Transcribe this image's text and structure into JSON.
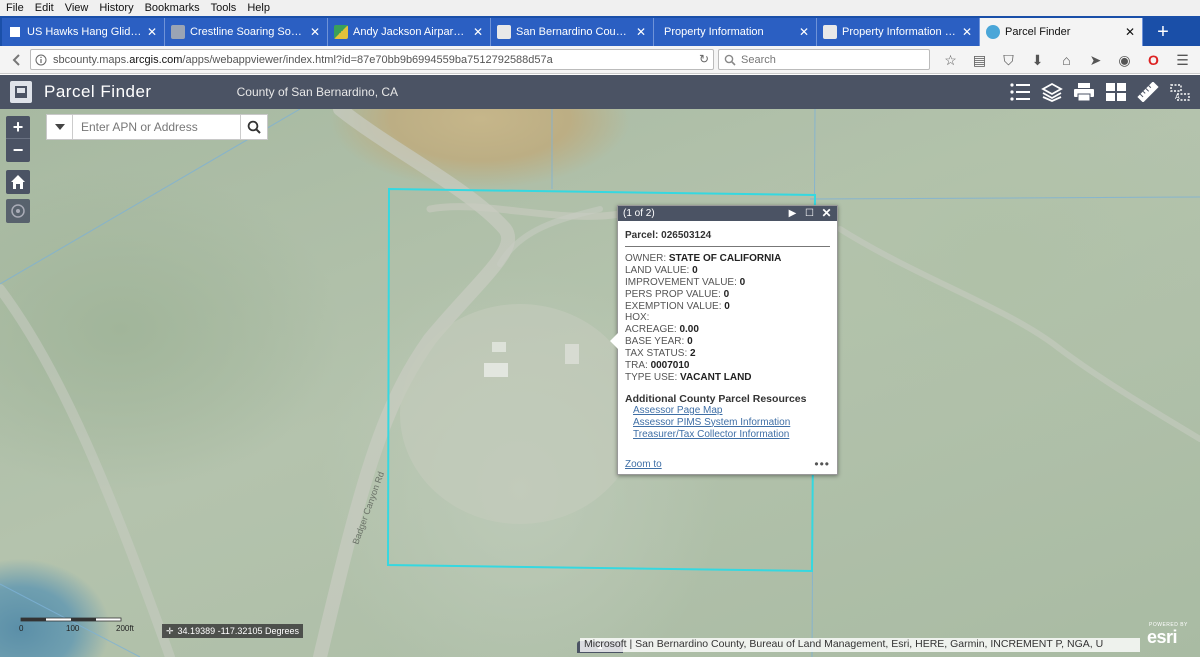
{
  "menu": [
    "File",
    "Edit",
    "View",
    "History",
    "Bookmarks",
    "Tools",
    "Help"
  ],
  "tabs": [
    {
      "label": "US Hawks Hang Gliding Assoc...",
      "fav_color": "#2b5fc2"
    },
    {
      "label": "Crestline Soaring Society |...",
      "fav_color": "#9aa4b4"
    },
    {
      "label": "Andy Jackson Airpark - Go...",
      "fav_color": "#3aa05a"
    },
    {
      "label": "San Bernardino County - C...",
      "fav_color": "#e8e8e8"
    },
    {
      "label": "Property Information",
      "fav_color": "#2b5fc2"
    },
    {
      "label": "Property Information Mana...",
      "fav_color": "#e8e8e8"
    },
    {
      "label": "Parcel Finder",
      "fav_color": "#4aa6d8"
    }
  ],
  "newtab": "+",
  "url": {
    "prefix": "sbcounty.maps.",
    "domain": "arcgis.com",
    "path": "/apps/webappviewer/index.html?id=87e70bb9b6994559ba7512792588d57a"
  },
  "browser_search": {
    "placeholder": "Search"
  },
  "app": {
    "title": "Parcel Finder",
    "subtitle": "County of San Bernardino, CA"
  },
  "search_widget": {
    "placeholder": "Enter APN or Address"
  },
  "map": {
    "road_label": "Badger Canyon Rd",
    "parcel_outline_color": "#35d8e0"
  },
  "zoom": {
    "in": "+",
    "out": "−"
  },
  "popup": {
    "page": "(1 of 2)",
    "title": "Parcel: 026503124",
    "fields": [
      {
        "label": "OWNER:",
        "value": "STATE OF CALIFORNIA"
      },
      {
        "label": "LAND VALUE:",
        "value": "0"
      },
      {
        "label": "IMPROVEMENT VALUE:",
        "value": "0"
      },
      {
        "label": "PERS PROP VALUE:",
        "value": "0"
      },
      {
        "label": "EXEMPTION VALUE:",
        "value": "0"
      },
      {
        "label": "HOX:",
        "value": ""
      },
      {
        "label": "ACREAGE:",
        "value": "0.00"
      },
      {
        "label": "BASE YEAR:",
        "value": "0"
      },
      {
        "label": "TAX STATUS:",
        "value": "2"
      },
      {
        "label": "TRA:",
        "value": "0007010"
      },
      {
        "label": "TYPE USE:",
        "value": "VACANT LAND"
      }
    ],
    "resources_title": "Additional County Parcel Resources",
    "links": [
      "Assessor Page Map",
      "Assessor PIMS System Information",
      "Treasurer/Tax Collector Information"
    ],
    "zoom_to": "Zoom to",
    "more": "•••"
  },
  "scale": {
    "t0": "0",
    "t1": "100",
    "t2": "200ft"
  },
  "coordinates": "34.19389 -117.32105 Degrees",
  "attribution": "Microsoft | San Bernardino County, Bureau of Land Management, Esri, HERE, Garmin, INCREMENT P, NGA, U",
  "esri": {
    "powered": "POWERED BY",
    "mark": "esri"
  }
}
